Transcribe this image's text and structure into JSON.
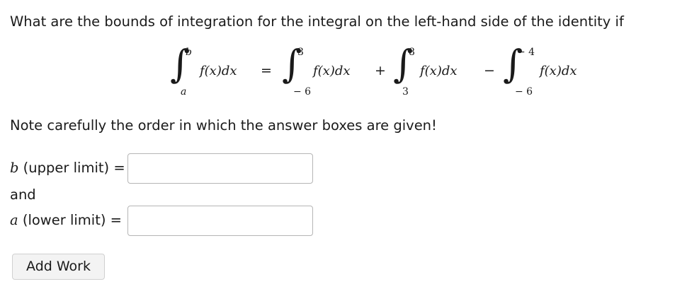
{
  "question": {
    "text": "What are the bounds of integration for the integral on the left-hand side of the identity if"
  },
  "equation": {
    "integrand": "f(x)dx",
    "integrals": [
      {
        "upper": "b",
        "lower": "a"
      },
      {
        "upper": "3",
        "lower": "− 6"
      },
      {
        "upper": "8",
        "lower": "3"
      },
      {
        "upper": "− 4",
        "lower": "− 6"
      }
    ],
    "operators": [
      "=",
      "+",
      "−"
    ]
  },
  "note": {
    "text": "Note carefully the order in which the answer boxes are given!"
  },
  "answers": {
    "upper": {
      "var": "b",
      "label": " (upper limit) =",
      "value": "",
      "placeholder": ""
    },
    "connector": "and",
    "lower": {
      "var": "a",
      "label": " (lower limit) =",
      "value": "",
      "placeholder": ""
    }
  },
  "buttons": {
    "add_work": "Add Work"
  }
}
